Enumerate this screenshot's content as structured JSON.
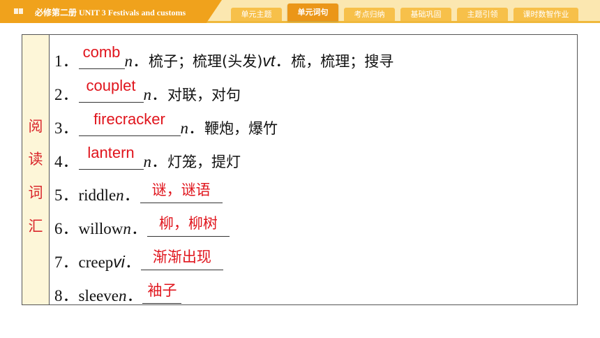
{
  "header": {
    "breadcrumb": "必修第二册   UNIT 3    Festivals and customs",
    "tabs": [
      {
        "label": "单元主题",
        "active": false
      },
      {
        "label": "单元词句",
        "active": true
      },
      {
        "label": "考点归纳",
        "active": false
      },
      {
        "label": "基础巩固",
        "active": false
      },
      {
        "label": "主题引领",
        "active": false
      },
      {
        "label": "课时数智作业",
        "active": false
      }
    ],
    "colors": {
      "bar": "#fbe7b0",
      "accent": "#f0a21c",
      "tab": "#f7c04a",
      "tab_active": "#eb9618"
    }
  },
  "section": {
    "side_label": [
      "阅",
      "读",
      "词",
      "汇"
    ],
    "label_color": "#d9262b",
    "items": [
      {
        "num": "1．",
        "word": "",
        "answer": "comb",
        "pos": "n",
        "sep": "．",
        "meaning": "梳子；梳理(头发)",
        "pos2": "vt",
        "sep2": "．",
        "meaning2": "梳，梳理；搜寻"
      },
      {
        "num": "2．",
        "word": "",
        "answer": "couplet",
        "pos": "n",
        "sep": "．",
        "meaning": "对联，对句"
      },
      {
        "num": "3．",
        "word": "",
        "answer": "firecracker",
        "pos": "n",
        "sep": "．",
        "meaning": "鞭炮，爆竹"
      },
      {
        "num": "4．",
        "word": "",
        "answer": "lantern",
        "pos": "n",
        "sep": "．",
        "meaning": "灯笼，提灯"
      },
      {
        "num": "5．",
        "word": "riddle ",
        "pos": "n",
        "sep": "．",
        "answer": "谜，谜语"
      },
      {
        "num": "6．",
        "word": "willow ",
        "pos": "n",
        "sep": "．",
        "answer": "柳，柳树"
      },
      {
        "num": "7．",
        "word": "creep ",
        "pos": "vi",
        "sep": "．",
        "answer": "渐渐出现"
      },
      {
        "num": "8．",
        "word": "sleeve ",
        "pos": "n",
        "sep": "．",
        "answer": "袖子"
      }
    ],
    "answer_color": "#e0141c"
  }
}
